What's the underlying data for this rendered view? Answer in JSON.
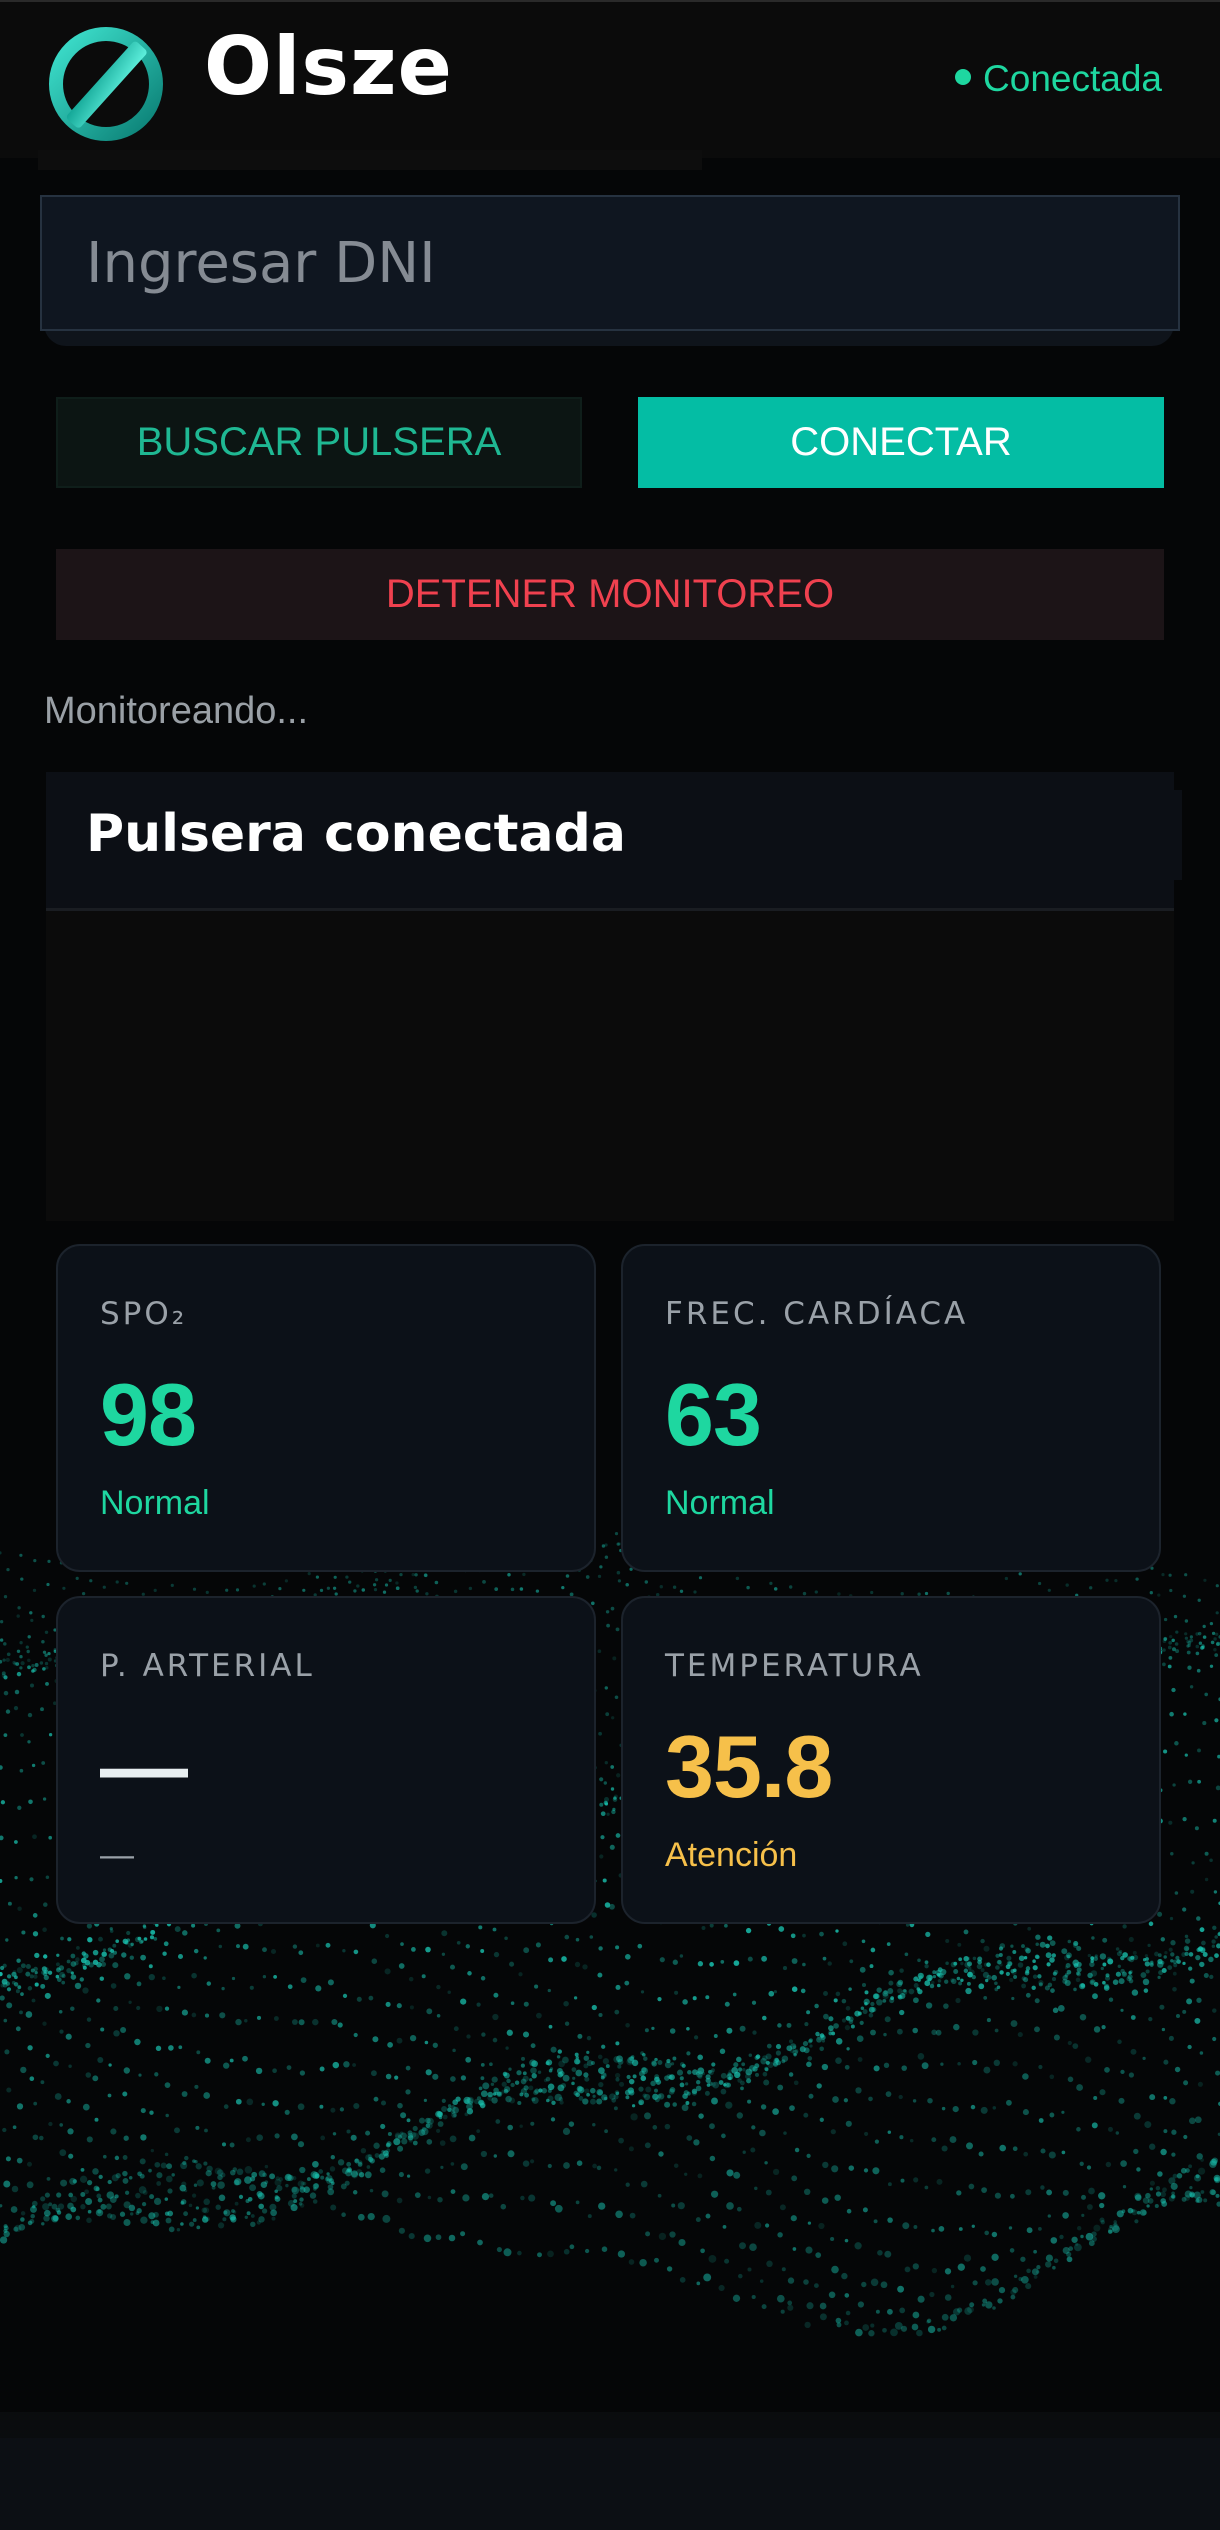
{
  "header": {
    "brand": "Olsze",
    "status": "Conectada"
  },
  "dni_input": {
    "placeholder": "Ingresar DNI",
    "value": ""
  },
  "buttons": {
    "scan": "BUSCAR PULSERA",
    "connect": "CONECTAR",
    "stop": "DETENER MONITOREO"
  },
  "monitor_status": "Monitoreando...",
  "panel": {
    "title": "Pulsera conectada"
  },
  "metrics": {
    "spo2": {
      "label": "SPO₂",
      "value": "98",
      "state": "Normal"
    },
    "heart_rate": {
      "label": "FREC. CARDÍACA",
      "value": "63",
      "state": "Normal"
    },
    "blood_pressure": {
      "label": "P. ARTERIAL",
      "value": "—",
      "state": "—"
    },
    "temperature": {
      "label": "TEMPERATURA",
      "value": "35.8",
      "state": "Atención"
    }
  },
  "colors": {
    "accent": "#04bda4",
    "normal": "#1ed7a0",
    "warning": "#f6c04a",
    "danger": "#f0414f",
    "background": "#050607"
  },
  "icons": {
    "logo": "olsze-logo-icon",
    "status": "status-dot-icon"
  }
}
